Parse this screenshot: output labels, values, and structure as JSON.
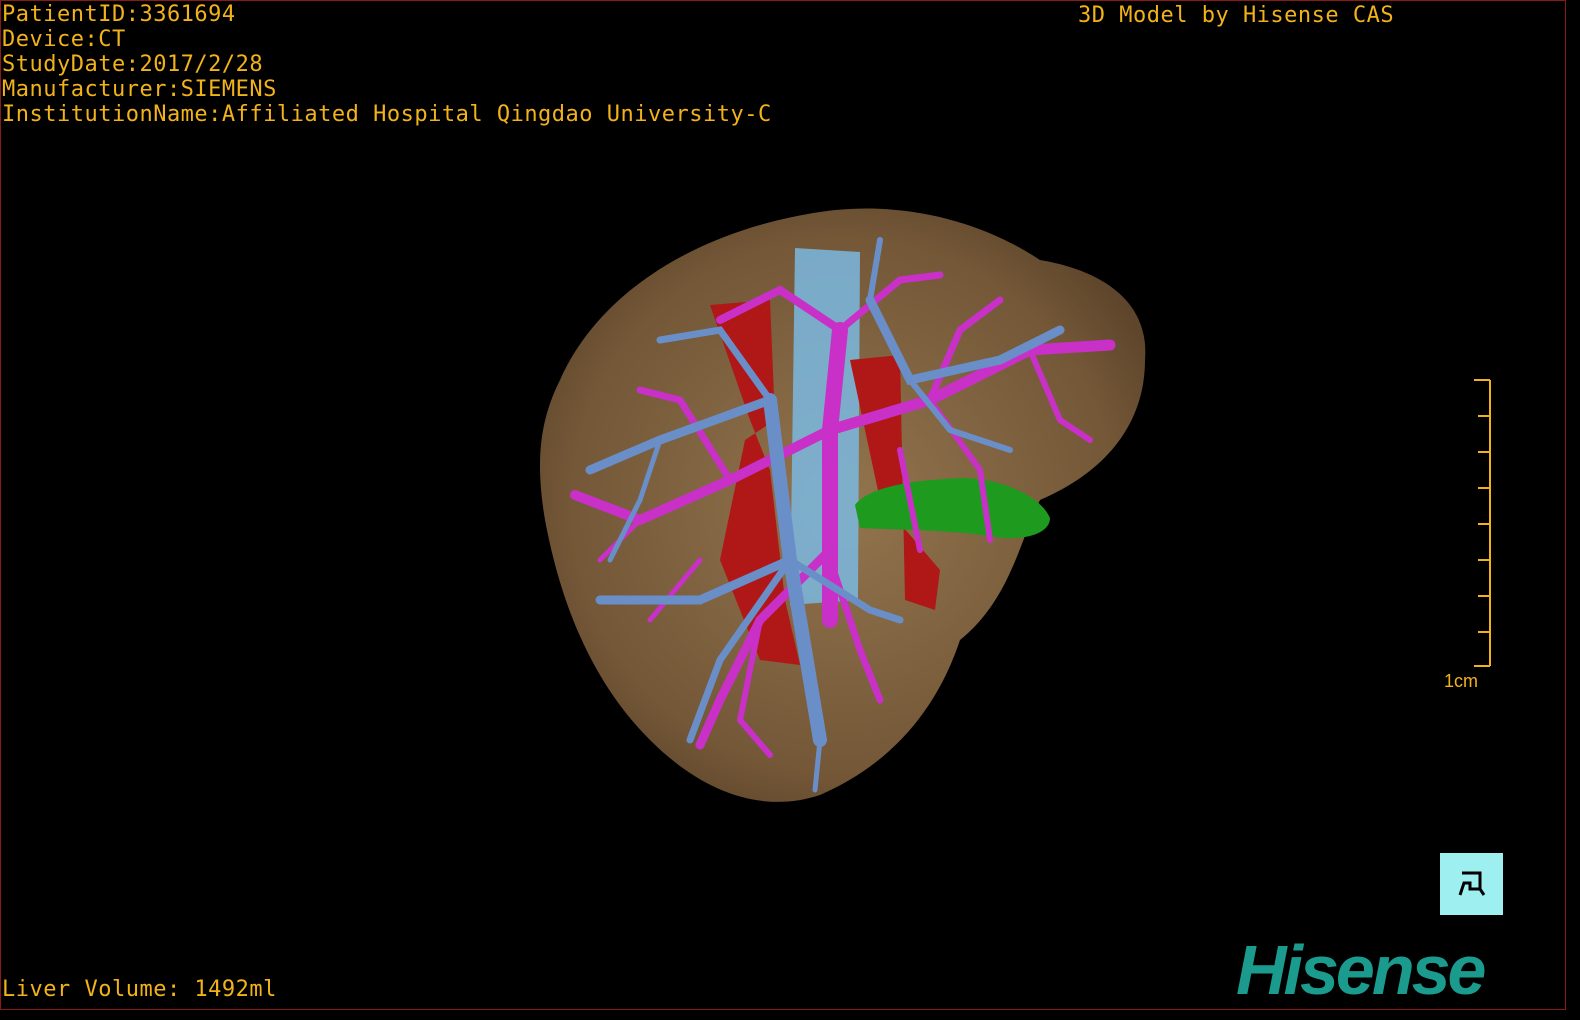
{
  "overlay": {
    "patient_id": "PatientID:3361694",
    "device": "Device:CT",
    "study_date": "StudyDate:2017/2/28",
    "manufacturer": "Manufacturer:SIEMENS",
    "institution": "InstitutionName:Affiliated Hospital Qingdao University-C",
    "model_credit": "3D Model by Hisense CAS",
    "liver_volume": "Liver Volume: 1492ml"
  },
  "scale_bar": {
    "label": "1cm"
  },
  "brand": {
    "logo_text": "Hisense"
  },
  "controls": {
    "orientation_icon": "orientation-cube-icon"
  },
  "colors": {
    "overlay_text": "#f2b21a",
    "liver": "#8a6a45",
    "portal_vein": "#c830c8",
    "hepatic_vein": "#6a8fc8",
    "ivc": "#7ab8e0",
    "artery": "#b01818",
    "gallbladder": "#1e9a1e",
    "logo": "#1a9b8e",
    "orientation_button": "#9ef0f0"
  }
}
